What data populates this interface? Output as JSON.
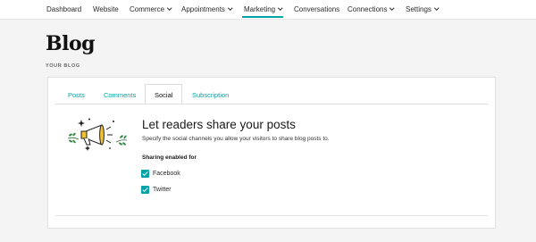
{
  "nav": {
    "items": [
      {
        "label": "Dashboard",
        "has_dropdown": false
      },
      {
        "label": "Website",
        "has_dropdown": false
      },
      {
        "label": "Commerce",
        "has_dropdown": true
      },
      {
        "label": "Appointments",
        "has_dropdown": true
      },
      {
        "label": "Marketing",
        "has_dropdown": true,
        "active": true
      },
      {
        "label": "Conversations",
        "has_dropdown": false
      },
      {
        "label": "Connections",
        "has_dropdown": true
      },
      {
        "label": "Settings",
        "has_dropdown": true
      }
    ]
  },
  "page": {
    "title": "Blog",
    "subtitle": "YOUR BLOG"
  },
  "tabs": [
    {
      "label": "Posts",
      "active": false
    },
    {
      "label": "Comments",
      "active": false
    },
    {
      "label": "Social",
      "active": true
    },
    {
      "label": "Subscription",
      "active": false
    }
  ],
  "social": {
    "title": "Let readers share your posts",
    "description": "Specify the social channels you allow your visitors to share blog posts to.",
    "sharing_label": "Sharing enabled for",
    "channels": [
      {
        "label": "Facebook",
        "checked": true
      },
      {
        "label": "Twitter",
        "checked": true
      }
    ],
    "illustration_icon": "megaphone-icon"
  },
  "colors": {
    "accent": "#00a4a6",
    "background": "#f4f4f4",
    "card": "#ffffff"
  }
}
